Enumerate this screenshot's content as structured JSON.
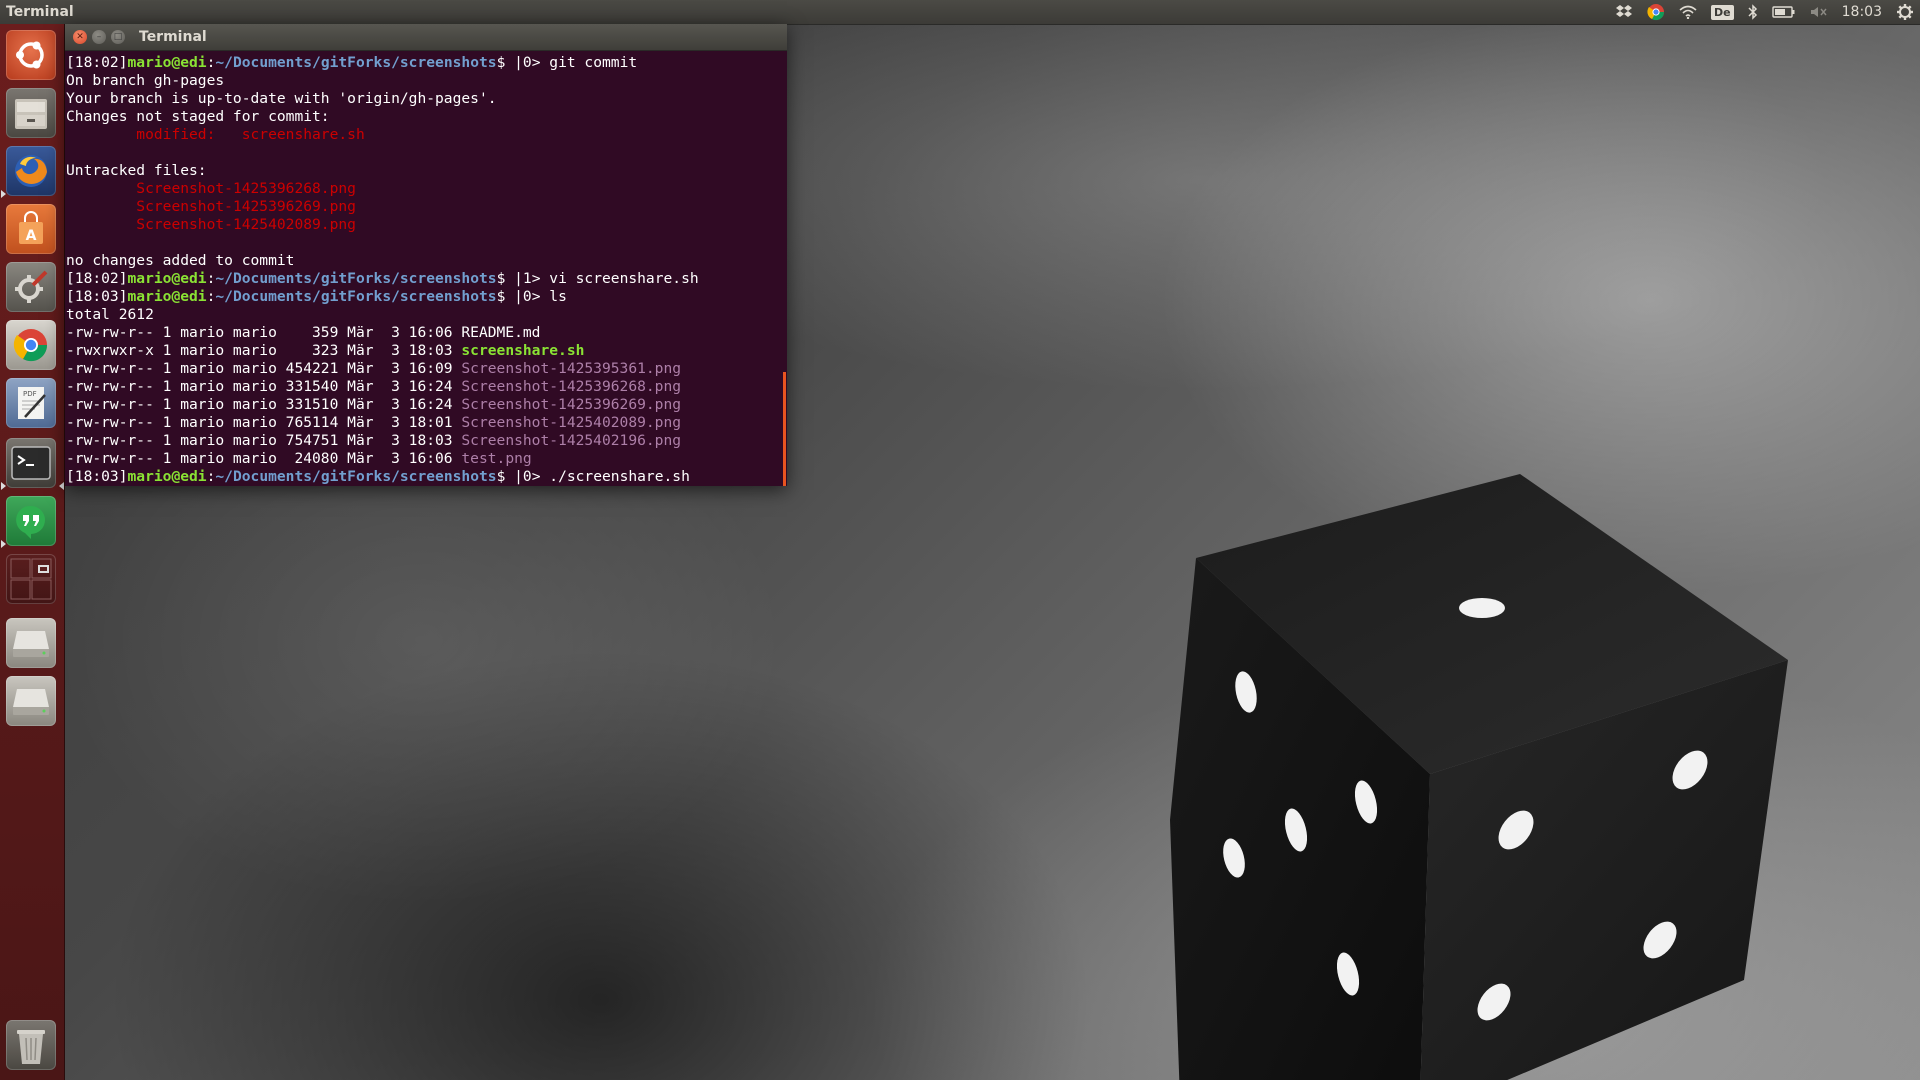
{
  "top_panel": {
    "app_title": "Terminal",
    "keyboard_layout": "De",
    "clock": "18:03"
  },
  "launcher": {
    "items": [
      {
        "name": "ubuntu-dash"
      },
      {
        "name": "files"
      },
      {
        "name": "firefox"
      },
      {
        "name": "ubuntu-software-center"
      },
      {
        "name": "system-settings"
      },
      {
        "name": "chromium"
      },
      {
        "name": "pdf-editor",
        "badge": "PDF"
      },
      {
        "name": "terminal"
      },
      {
        "name": "hangouts"
      },
      {
        "name": "workspace-switcher"
      },
      {
        "name": "drive-1"
      },
      {
        "name": "drive-2"
      },
      {
        "name": "trash"
      }
    ]
  },
  "terminal": {
    "title": "Terminal",
    "lines": [
      {
        "parts": [
          {
            "t": "[18:02]"
          },
          {
            "t": "mario@edi",
            "c": "user"
          },
          {
            "t": ":"
          },
          {
            "t": "~/Documents/gitForks/screenshots",
            "c": "path"
          },
          {
            "t": "$ |0> git commit"
          }
        ]
      },
      {
        "parts": [
          {
            "t": "On branch gh-pages"
          }
        ]
      },
      {
        "parts": [
          {
            "t": "Your branch is up-to-date with 'origin/gh-pages'."
          }
        ]
      },
      {
        "parts": [
          {
            "t": "Changes not staged for commit:"
          }
        ]
      },
      {
        "parts": [
          {
            "t": "        "
          },
          {
            "t": "modified:   screenshare.sh",
            "c": "red"
          }
        ]
      },
      {
        "parts": [
          {
            "t": ""
          }
        ]
      },
      {
        "parts": [
          {
            "t": "Untracked files:"
          }
        ]
      },
      {
        "parts": [
          {
            "t": "        "
          },
          {
            "t": "Screenshot-1425396268.png",
            "c": "red"
          }
        ]
      },
      {
        "parts": [
          {
            "t": "        "
          },
          {
            "t": "Screenshot-1425396269.png",
            "c": "red"
          }
        ]
      },
      {
        "parts": [
          {
            "t": "        "
          },
          {
            "t": "Screenshot-1425402089.png",
            "c": "red"
          }
        ]
      },
      {
        "parts": [
          {
            "t": ""
          }
        ]
      },
      {
        "parts": [
          {
            "t": "no changes added to commit"
          }
        ]
      },
      {
        "parts": [
          {
            "t": "[18:02]"
          },
          {
            "t": "mario@edi",
            "c": "user"
          },
          {
            "t": ":"
          },
          {
            "t": "~/Documents/gitForks/screenshots",
            "c": "path"
          },
          {
            "t": "$ |1> vi screenshare.sh"
          }
        ]
      },
      {
        "parts": [
          {
            "t": "[18:03]"
          },
          {
            "t": "mario@edi",
            "c": "user"
          },
          {
            "t": ":"
          },
          {
            "t": "~/Documents/gitForks/screenshots",
            "c": "path"
          },
          {
            "t": "$ |0> ls"
          }
        ]
      },
      {
        "parts": [
          {
            "t": "total 2612"
          }
        ]
      },
      {
        "parts": [
          {
            "t": "-rw-rw-r-- 1 mario mario    359 Mär  3 16:06 README.md"
          }
        ]
      },
      {
        "parts": [
          {
            "t": "-rwxrwxr-x 1 mario mario    323 Mär  3 18:03 "
          },
          {
            "t": "screenshare.sh",
            "c": "exec"
          }
        ]
      },
      {
        "parts": [
          {
            "t": "-rw-rw-r-- 1 mario mario 454221 Mär  3 16:09 "
          },
          {
            "t": "Screenshot-1425395361.png",
            "c": "img"
          }
        ]
      },
      {
        "parts": [
          {
            "t": "-rw-rw-r-- 1 mario mario 331540 Mär  3 16:24 "
          },
          {
            "t": "Screenshot-1425396268.png",
            "c": "img"
          }
        ]
      },
      {
        "parts": [
          {
            "t": "-rw-rw-r-- 1 mario mario 331510 Mär  3 16:24 "
          },
          {
            "t": "Screenshot-1425396269.png",
            "c": "img"
          }
        ]
      },
      {
        "parts": [
          {
            "t": "-rw-rw-r-- 1 mario mario 765114 Mär  3 18:01 "
          },
          {
            "t": "Screenshot-1425402089.png",
            "c": "img"
          }
        ]
      },
      {
        "parts": [
          {
            "t": "-rw-rw-r-- 1 mario mario 754751 Mär  3 18:03 "
          },
          {
            "t": "Screenshot-1425402196.png",
            "c": "img"
          }
        ]
      },
      {
        "parts": [
          {
            "t": "-rw-rw-r-- 1 mario mario  24080 Mär  3 16:06 "
          },
          {
            "t": "test.png",
            "c": "img"
          }
        ]
      },
      {
        "parts": [
          {
            "t": "[18:03]"
          },
          {
            "t": "mario@edi",
            "c": "user"
          },
          {
            "t": ":"
          },
          {
            "t": "~/Documents/gitForks/screenshots",
            "c": "path"
          },
          {
            "t": "$ |0> ./screenshare.sh"
          }
        ]
      }
    ]
  },
  "colors": {
    "terminal_bg": "#300a24",
    "launcher_bg": "#5a1a1a",
    "accent": "#e95420",
    "prompt_user": "#8ae234",
    "prompt_path": "#729fcf",
    "git_red": "#cc0000",
    "image_file": "#ad7fa8"
  }
}
